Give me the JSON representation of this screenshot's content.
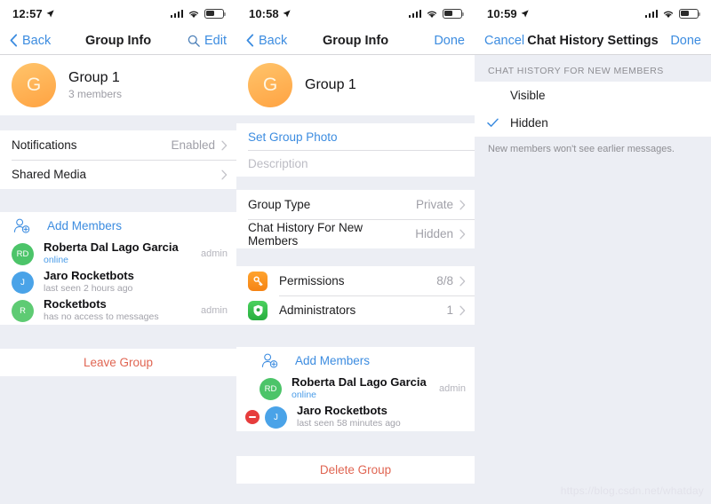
{
  "colors": {
    "accent": "#3c8ce0",
    "danger": "#e06552",
    "bg": "#eceef4",
    "card": "#ffffff",
    "muted": "#a0a0a8",
    "avatar_orange": "#ffa342",
    "avatar_green": "#4cc469",
    "avatar_blue": "#4aa3e8",
    "avatar_green_light": "#5ecb73",
    "delete_red": "#e63c3c",
    "tile_orange": "#f58415",
    "tile_green": "#27ae3f"
  },
  "panel1": {
    "status": {
      "time": "12:57",
      "location_icon": "location-arrow-icon",
      "signal_icon": "cellular-bars-icon",
      "wifi_icon": "wifi-icon",
      "battery_icon": "battery-icon"
    },
    "nav": {
      "back_label": "Back",
      "title": "Group Info",
      "search_icon": "search-icon",
      "edit_label": "Edit"
    },
    "group": {
      "avatar_initial": "G",
      "name": "Group 1",
      "members_count": "3 members"
    },
    "settings": [
      {
        "label": "Notifications",
        "value": "Enabled",
        "chevron": "chevron-right-icon"
      },
      {
        "label": "Shared Media",
        "value": "",
        "chevron": "chevron-right-icon"
      }
    ],
    "add_members": {
      "icon": "add-member-icon",
      "label": "Add Members"
    },
    "members": [
      {
        "initials": "RD",
        "color": "#4cc469",
        "name": "Roberta Dal Lago Garcia",
        "status": "online",
        "online": true,
        "badge": "admin"
      },
      {
        "initials": "J",
        "color": "#4aa3e8",
        "name": "Jaro Rocketbots",
        "status": "last seen 2 hours ago",
        "online": false,
        "badge": ""
      },
      {
        "initials": "R",
        "color": "#5ecb73",
        "name": "Rocketbots",
        "status": "has no access to messages",
        "online": false,
        "badge": "admin"
      }
    ],
    "leave_label": "Leave Group"
  },
  "panel2": {
    "status": {
      "time": "10:58",
      "location_icon": "location-arrow-icon",
      "signal_icon": "cellular-bars-icon",
      "wifi_icon": "wifi-icon",
      "battery_icon": "battery-icon"
    },
    "nav": {
      "back_label": "Back",
      "title": "Group Info",
      "done_label": "Done"
    },
    "group": {
      "avatar_initial": "G",
      "name": "Group 1"
    },
    "set_photo_label": "Set Group Photo",
    "description_placeholder": "Description",
    "settings": [
      {
        "label": "Group Type",
        "value": "Private",
        "chevron": "chevron-right-icon"
      },
      {
        "label": "Chat History For New Members",
        "value": "Hidden",
        "chevron": "chevron-right-icon"
      }
    ],
    "admin_rows": [
      {
        "icon": "key-icon",
        "tile": "orange",
        "label": "Permissions",
        "value": "8/8",
        "chevron": "chevron-right-icon"
      },
      {
        "icon": "shield-star-icon",
        "tile": "green",
        "label": "Administrators",
        "value": "1",
        "chevron": "chevron-right-icon"
      }
    ],
    "add_members": {
      "icon": "add-member-icon",
      "label": "Add Members"
    },
    "members": [
      {
        "initials": "RD",
        "color": "#4cc469",
        "name": "Roberta Dal Lago Garcia",
        "status": "online",
        "online": true,
        "badge": "admin",
        "deletable": false
      },
      {
        "initials": "J",
        "color": "#4aa3e8",
        "name": "Jaro Rocketbots",
        "status": "last seen 58 minutes ago",
        "online": false,
        "badge": "",
        "deletable": true
      }
    ],
    "delete_label": "Delete Group"
  },
  "panel3": {
    "status": {
      "time": "10:59",
      "location_icon": "location-arrow-icon",
      "signal_icon": "cellular-bars-icon",
      "wifi_icon": "wifi-icon",
      "battery_icon": "battery-icon"
    },
    "nav": {
      "cancel_label": "Cancel",
      "title": "Chat History Settings",
      "done_label": "Done"
    },
    "section_header": "CHAT HISTORY FOR NEW MEMBERS",
    "options": [
      {
        "label": "Visible",
        "selected": false
      },
      {
        "label": "Hidden",
        "selected": true
      }
    ],
    "footer_note": "New members won't see earlier messages."
  },
  "watermark": "https://blog.csdn.net/whatday"
}
